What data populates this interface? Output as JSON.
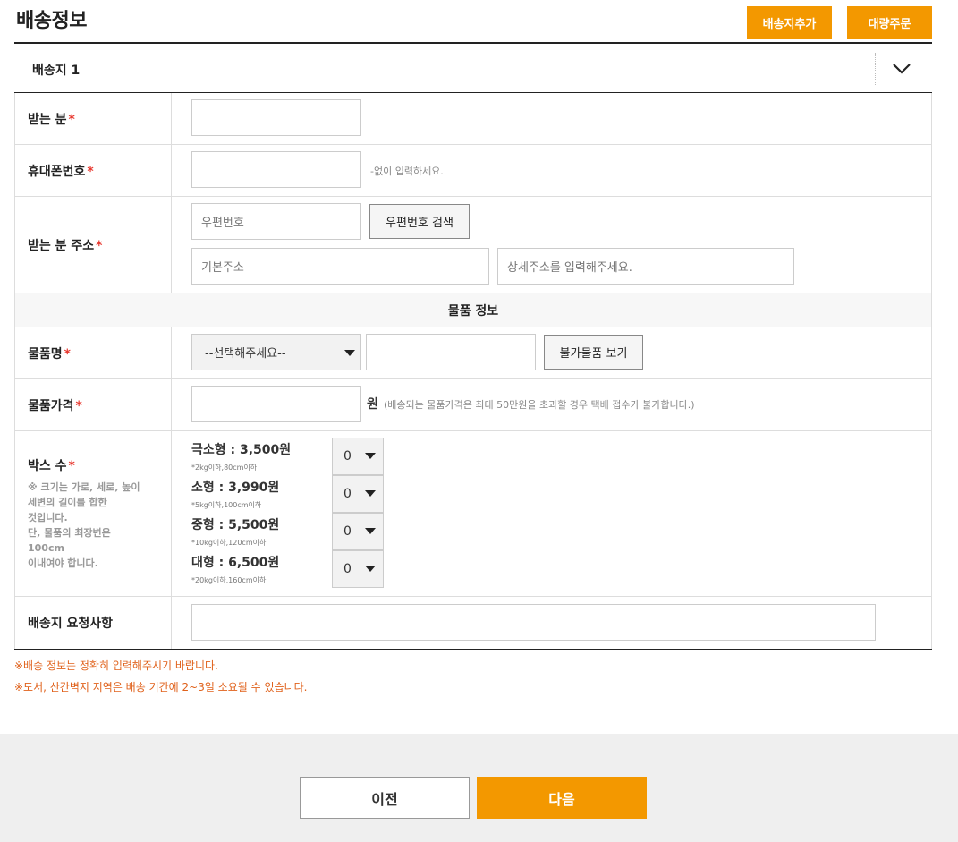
{
  "header": {
    "title": "배송정보",
    "add_address_label": "배송지추가",
    "bulk_order_label": "대량주문"
  },
  "section": {
    "label": "배송지 1",
    "toggle_icon": "chevron-down-icon"
  },
  "form": {
    "recipient": {
      "label": "받는 분",
      "required": "*",
      "value": ""
    },
    "phone": {
      "label": "휴대폰번호",
      "required": "*",
      "value": "",
      "hint": "-없이 입력하세요."
    },
    "address": {
      "label": "받는 분 주소",
      "required": "*",
      "zip_placeholder": "우편번호",
      "zip_search_label": "우편번호 검색",
      "base_placeholder": "기본주소",
      "detail_placeholder": "상세주소를 입력해주세요."
    },
    "item_section_title": "물품 정보",
    "item_name": {
      "label": "물품명",
      "required": "*",
      "select_value": "--선택해주세요--",
      "value": "",
      "prohibited_label": "불가물품 보기"
    },
    "item_price": {
      "label": "물품가격",
      "required": "*",
      "value": "",
      "unit": "원",
      "hint": "(배송되는 물품가격은 최대 50만원을 초과할 경우 택배 접수가 불가합니다.)"
    },
    "box_count": {
      "label": "박스 수",
      "required": "*",
      "note_lines": [
        "※ 크기는 가로, 세로, 높이",
        "세변의 길이를 합한",
        "것입니다.",
        "단, 물품의 최장변은",
        "100cm",
        "이내여야 합니다."
      ],
      "items": [
        {
          "title": "극소형 : 3,500원",
          "sub": "*2kg이하,80cm이하",
          "value": "0"
        },
        {
          "title": "소형 : 3,990원",
          "sub": "*5kg이하,100cm이하",
          "value": "0"
        },
        {
          "title": "중형 : 5,500원",
          "sub": "*10kg이하,120cm이하",
          "value": "0"
        },
        {
          "title": "대형 : 6,500원",
          "sub": "*20kg이하,160cm이하",
          "value": "0"
        }
      ]
    },
    "request": {
      "label": "배송지 요청사항",
      "value": ""
    }
  },
  "notices": [
    "※배송 정보는 정확히 입력해주시기 바랍니다.",
    "※도서, 산간벽지 지역은 배송 기간에 2~3일 소요될 수 있습니다."
  ],
  "footer": {
    "prev_label": "이전",
    "next_label": "다음"
  },
  "colors": {
    "accent": "#f39800",
    "required": "#e8382f",
    "notice": "#e0621c"
  }
}
